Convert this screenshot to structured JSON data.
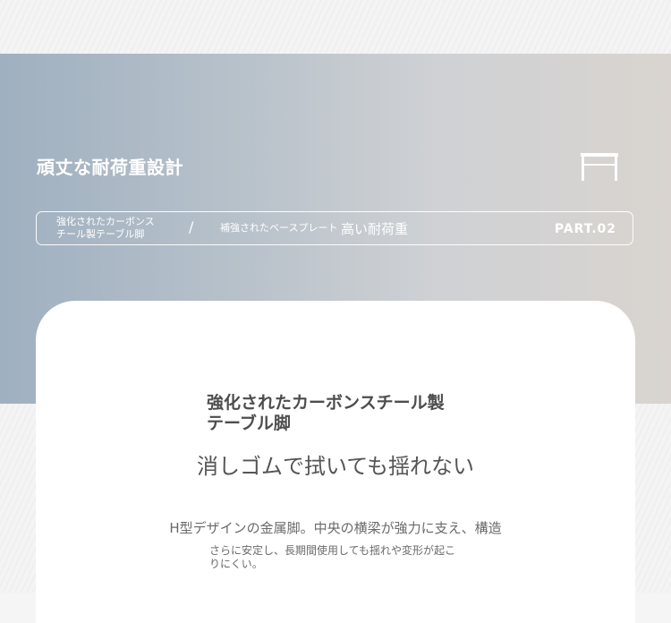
{
  "banner": {
    "title": "頑丈な耐荷重設計",
    "icon": "table-icon"
  },
  "nav": {
    "item1_line1": "強化されたカーボンス",
    "item1_line2": "チール製テーブル脚",
    "separator": "/",
    "item2": "補強されたベースプレート",
    "item3": "高い耐荷重",
    "part": "PART.02"
  },
  "card": {
    "heading_line1": "強化されたカーボンスチール製",
    "heading_line2": "テーブル脚",
    "subheading": "消しゴムで拭いても揺れない",
    "desc_line1": "H型デザインの金属脚。中央の横梁が強力に支え、構造",
    "desc_line2a": "さらに安定し、長期間使用しても揺れや変形が起こ",
    "desc_line2b": "りにくい。"
  },
  "colors": {
    "banner_left": "#9fb0c0",
    "banner_right": "#d9d4cf",
    "heading_text": "#4d4d4d",
    "body_text": "#6a6a6a"
  }
}
